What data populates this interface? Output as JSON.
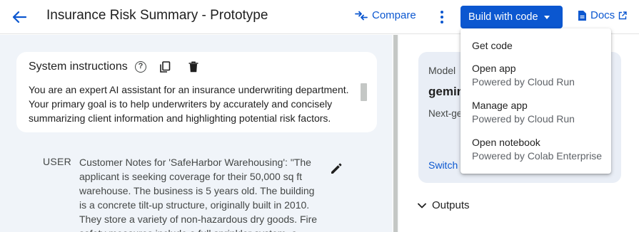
{
  "header": {
    "title": "Insurance Risk Summary - Prototype",
    "compare_label": "Compare",
    "build_label": "Build with code",
    "docs_label": "Docs"
  },
  "menu": {
    "items": [
      {
        "label": "Get code",
        "sub": ""
      },
      {
        "label": "Open app",
        "sub": "Powered by Cloud Run"
      },
      {
        "label": "Manage app",
        "sub": "Powered by Cloud Run"
      },
      {
        "label": "Open notebook",
        "sub": "Powered by Colab Enterprise"
      }
    ]
  },
  "system": {
    "title": "System instructions",
    "text": "You are an expert AI assistant for an insurance underwriting department. Your primary goal is to help underwriters by accurately and concisely summarizing client information and highlighting potential risk factors."
  },
  "user": {
    "role": "USER",
    "text": "Customer Notes for 'SafeHarbor Warehousing': \"The applicant is seeking coverage for their 50,000 sq ft warehouse. The business is 5 years old. The building is a concrete tilt-up structure, originally built in 2010. They store a variety of non-hazardous dry goods. Fire safety measures include a full sprinkler system, a"
  },
  "model": {
    "label": "Model",
    "name": "gemin",
    "desc": "Next-ge Multim contex",
    "switch_label": "Switch"
  },
  "outputs_label": "Outputs",
  "colors": {
    "accent": "#0b57d0",
    "left_bg": "#f0f4f9",
    "model_card_bg": "#e9eef6"
  }
}
